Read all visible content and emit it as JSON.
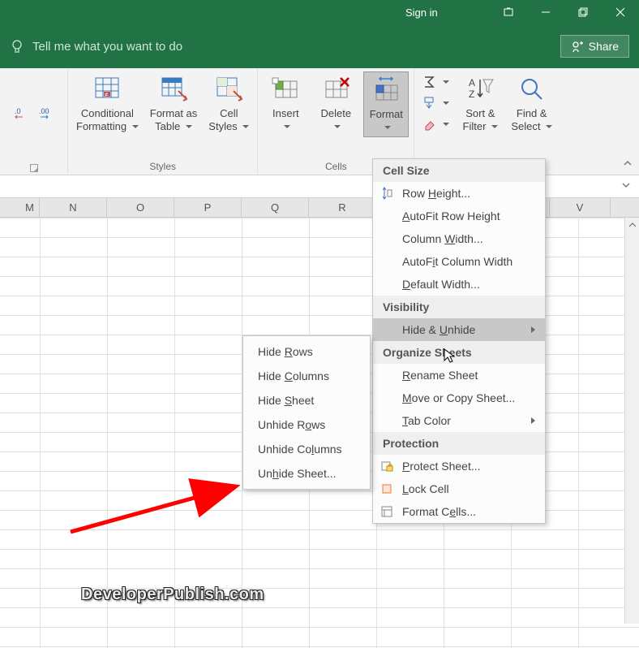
{
  "titlebar": {
    "signin": "Sign in"
  },
  "tellme": {
    "prompt": "Tell me what you want to do",
    "share": "Share"
  },
  "ribbon": {
    "number": {
      "decrease": ".0",
      "increase": ".00"
    },
    "conditional": "Conditional\nFormatting",
    "format_table": "Format as\nTable",
    "cell_styles": "Cell\nStyles",
    "styles_group": "Styles",
    "insert": "Insert",
    "delete": "Delete",
    "format": "Format",
    "cells_group": "Cells",
    "sort_filter": "Sort &\nFilter",
    "find_select": "Find &\nSelect"
  },
  "columns": [
    "M",
    "N",
    "O",
    "P",
    "Q",
    "R",
    "",
    "",
    "V"
  ],
  "format_menu": {
    "cell_size": "Cell Size",
    "row_height": "Row Height...",
    "autofit_row": "AutoFit Row Height",
    "column_width": "Column Width...",
    "autofit_col": "AutoFit Column Width",
    "default_width": "Default Width...",
    "visibility": "Visibility",
    "hide_unhide": "Hide & Unhide",
    "organize": "Organize Sheets",
    "rename": "Rename Sheet",
    "move_copy": "Move or Copy Sheet...",
    "tab_color": "Tab Color",
    "protection": "Protection",
    "protect_sheet": "Protect Sheet...",
    "lock_cell": "Lock Cell",
    "format_cells": "Format Cells..."
  },
  "submenu": {
    "hide_rows": "Hide Rows",
    "hide_columns": "Hide Columns",
    "hide_sheet": "Hide Sheet",
    "unhide_rows": "Unhide Rows",
    "unhide_columns": "Unhide Columns",
    "unhide_sheet": "Unhide Sheet..."
  },
  "watermark": "DeveloperPublish.com"
}
